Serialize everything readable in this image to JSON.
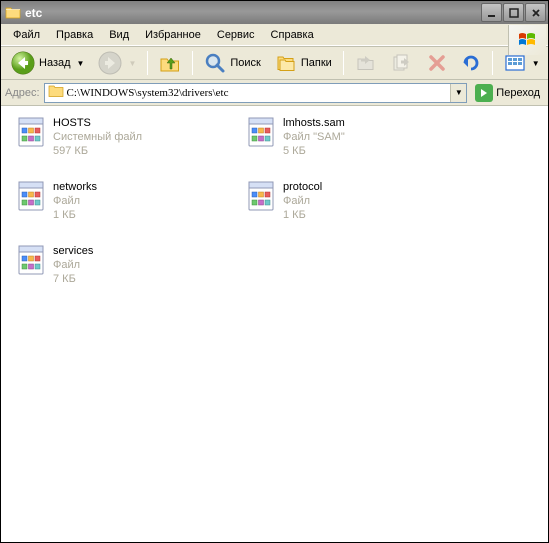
{
  "window": {
    "title": "etc"
  },
  "menu": {
    "file": "Файл",
    "edit": "Правка",
    "view": "Вид",
    "favorites": "Избранное",
    "tools": "Сервис",
    "help": "Справка"
  },
  "toolbar": {
    "back": "Назад",
    "search": "Поиск",
    "folders": "Папки"
  },
  "address": {
    "label": "Адрес:",
    "value": "C:\\WINDOWS\\system32\\drivers\\etc",
    "go": "Переход"
  },
  "files": [
    {
      "name": "HOSTS",
      "type": "Системный файл",
      "size": "597 КБ"
    },
    {
      "name": "lmhosts.sam",
      "type": "Файл \"SAM\"",
      "size": "5 КБ"
    },
    {
      "name": "networks",
      "type": "Файл",
      "size": "1 КБ"
    },
    {
      "name": "protocol",
      "type": "Файл",
      "size": "1 КБ"
    },
    {
      "name": "services",
      "type": "Файл",
      "size": "7 КБ"
    }
  ]
}
